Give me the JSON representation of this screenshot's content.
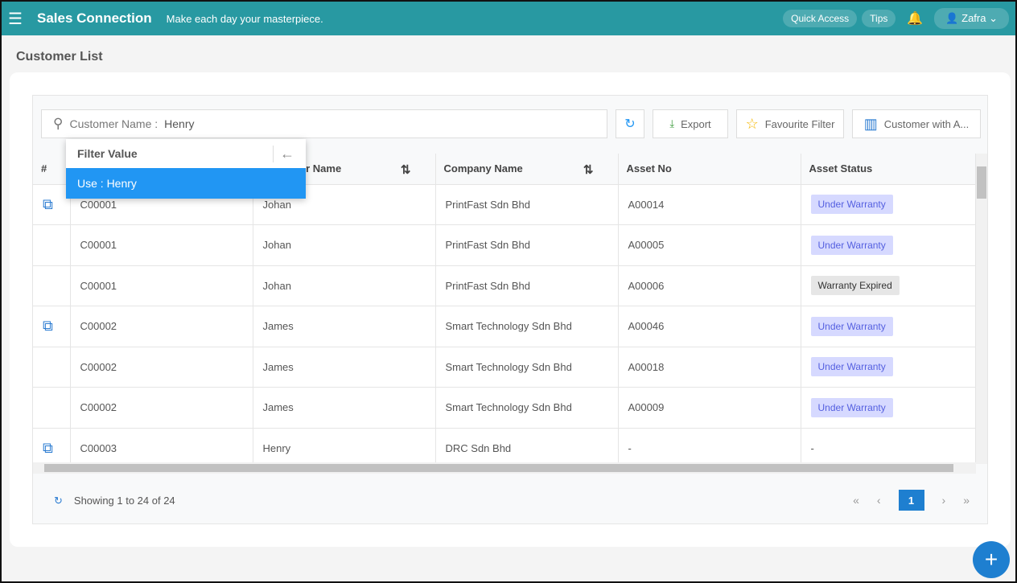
{
  "header": {
    "app_name": "Sales Connection",
    "tagline": "Make each day your masterpiece.",
    "quick_access": "Quick Access",
    "tips": "Tips",
    "user": "Zafra"
  },
  "page_title": "Customer List",
  "search": {
    "field": "Customer Name :",
    "value": "Henry"
  },
  "toolbar": {
    "export": "Export",
    "favourite": "Favourite Filter",
    "columns": "Customer with A..."
  },
  "popup": {
    "title": "Filter Value",
    "option": "Use : Henry"
  },
  "table": {
    "columns": [
      "#",
      "",
      "Customer Name",
      "Company Name",
      "Asset No",
      "Asset Status"
    ],
    "rows": [
      {
        "link": true,
        "id": "C00001",
        "name": "Johan",
        "company": "PrintFast Sdn Bhd",
        "asset": "A00014",
        "status": "Under Warranty"
      },
      {
        "link": false,
        "id": "C00001",
        "name": "Johan",
        "company": "PrintFast Sdn Bhd",
        "asset": "A00005",
        "status": "Under Warranty"
      },
      {
        "link": false,
        "id": "C00001",
        "name": "Johan",
        "company": "PrintFast Sdn Bhd",
        "asset": "A00006",
        "status": "Warranty Expired"
      },
      {
        "link": true,
        "id": "C00002",
        "name": "James",
        "company": "Smart Technology Sdn Bhd",
        "asset": "A00046",
        "status": "Under Warranty"
      },
      {
        "link": false,
        "id": "C00002",
        "name": "James",
        "company": "Smart Technology Sdn Bhd",
        "asset": "A00018",
        "status": "Under Warranty"
      },
      {
        "link": false,
        "id": "C00002",
        "name": "James",
        "company": "Smart Technology Sdn Bhd",
        "asset": "A00009",
        "status": "Under Warranty"
      },
      {
        "link": true,
        "id": "C00003",
        "name": "Henry",
        "company": "DRC Sdn Bhd",
        "asset": "-",
        "status": "-"
      }
    ]
  },
  "footer": {
    "showing": "Showing 1 to 24 of 24",
    "page": "1"
  },
  "colors": {
    "header": "#2899a2",
    "accent": "#1e7fd0",
    "under_warranty": "#d6d9ff"
  }
}
